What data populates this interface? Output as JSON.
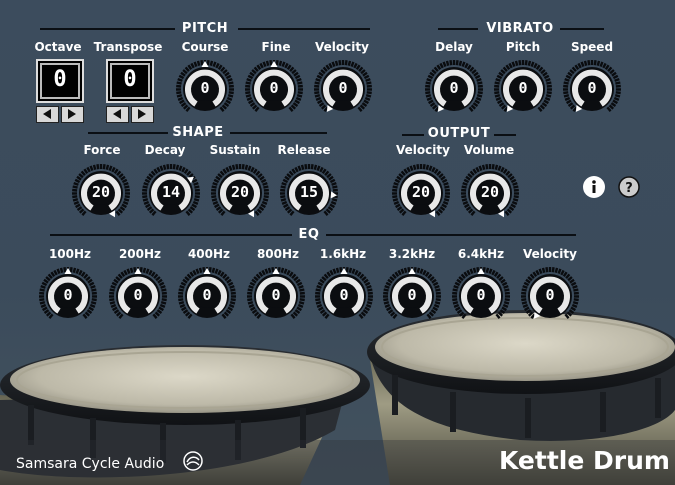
{
  "sections": {
    "pitch": "PITCH",
    "vibrato": "VIBRATO",
    "shape": "SHAPE",
    "output": "OUTPUT",
    "eq": "EQ"
  },
  "pitch": {
    "octave": {
      "label": "Octave",
      "value": "0"
    },
    "transpose": {
      "label": "Transpose",
      "value": "0"
    },
    "knobs": [
      {
        "label": "Course",
        "value": "0"
      },
      {
        "label": "Fine",
        "value": "0"
      },
      {
        "label": "Velocity",
        "value": "0"
      }
    ]
  },
  "vibrato": {
    "knobs": [
      {
        "label": "Delay",
        "value": "0"
      },
      {
        "label": "Pitch",
        "value": "0"
      },
      {
        "label": "Speed",
        "value": "0"
      }
    ]
  },
  "shape": {
    "knobs": [
      {
        "label": "Force",
        "value": "20"
      },
      {
        "label": "Decay",
        "value": "14"
      },
      {
        "label": "Sustain",
        "value": "20"
      },
      {
        "label": "Release",
        "value": "15"
      }
    ]
  },
  "output": {
    "knobs": [
      {
        "label": "Velocity",
        "value": "20"
      },
      {
        "label": "Volume",
        "value": "20"
      }
    ]
  },
  "eq": {
    "knobs": [
      {
        "label": "100Hz",
        "value": "0"
      },
      {
        "label": "200Hz",
        "value": "0"
      },
      {
        "label": "400Hz",
        "value": "0"
      },
      {
        "label": "800Hz",
        "value": "0"
      },
      {
        "label": "1.6kHz",
        "value": "0"
      },
      {
        "label": "3.2kHz",
        "value": "0"
      },
      {
        "label": "6.4kHz",
        "value": "0"
      },
      {
        "label": "Velocity",
        "value": "0"
      }
    ]
  },
  "buttons": {
    "info_icon": "info-icon",
    "help_icon": "help-icon"
  },
  "footer": {
    "brand": "Samsara Cycle Audio",
    "product": "Kettle Drum"
  }
}
